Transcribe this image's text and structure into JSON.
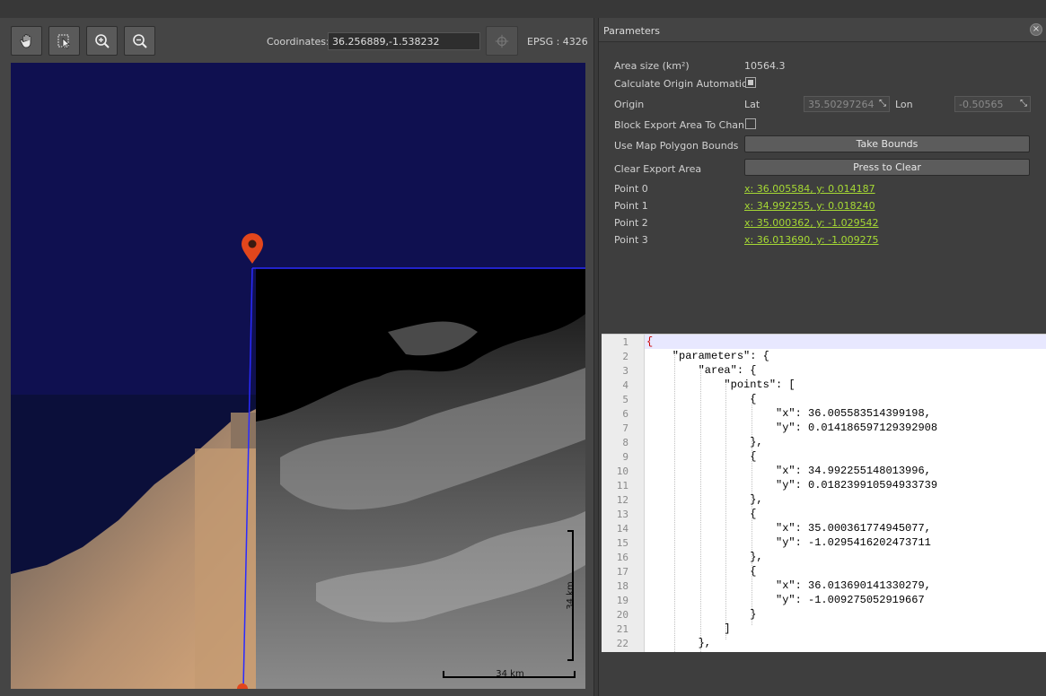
{
  "toolbar": {
    "tools": [
      {
        "name": "pan-tool",
        "icon": "hand-icon"
      },
      {
        "name": "select-tool",
        "icon": "select-cursor-icon"
      },
      {
        "name": "zoom-in-tool",
        "icon": "zoom-in-icon"
      },
      {
        "name": "zoom-out-tool",
        "icon": "zoom-out-icon"
      }
    ],
    "coordinates_label": "Coordinates:",
    "coordinates_value": "36.256889,-1.538232",
    "go_icon": "locate-icon",
    "epsg_label": "EPSG : 4326"
  },
  "map": {
    "scale_label_vertical": "34 km",
    "scale_label_horizontal": "34 km",
    "marker_icon": "map-pin-icon",
    "colors": {
      "water": "#0f1050",
      "marker": "#e2461c",
      "polygon": "#2a2aff"
    }
  },
  "parameters": {
    "title": "Parameters",
    "rows": {
      "area_size_label": "Area size (km²)",
      "area_size_value": "10564.3",
      "calc_origin_label": "Calculate Origin Automatic...",
      "calc_origin_checked": true,
      "origin_label": "Origin",
      "lat_label": "Lat",
      "lat_value": "35.50297264",
      "lon_label": "Lon",
      "lon_value": "-0.50565",
      "block_export_label": "Block Export Area To Chan...",
      "block_export_checked": false,
      "use_bounds_label": "Use Map Polygon Bounds",
      "take_bounds_button": "Take Bounds",
      "clear_export_label": "Clear Export Area",
      "clear_button": "Press to Clear"
    },
    "points": [
      {
        "label": "Point 0",
        "value": "x: 36.005584, y: 0.014187"
      },
      {
        "label": "Point 1",
        "value": "x: 34.992255, y: 0.018240"
      },
      {
        "label": "Point 2",
        "value": "x: 35.000362, y: -1.029542"
      },
      {
        "label": "Point 3",
        "value": "x: 36.013690, y: -1.009275"
      }
    ]
  },
  "editor": {
    "line_numbers": [
      "1",
      "2",
      "3",
      "4",
      "5",
      "6",
      "7",
      "8",
      "9",
      "10",
      "11",
      "12",
      "13",
      "14",
      "15",
      "16",
      "17",
      "18",
      "19",
      "20",
      "21",
      "22"
    ],
    "lines": [
      "{",
      "    \"parameters\": {",
      "        \"area\": {",
      "            \"points\": [",
      "                {",
      "                    \"x\": 36.005583514399198,",
      "                    \"y\": 0.014186597129392908",
      "                },",
      "                {",
      "                    \"x\": 34.992255148013996,",
      "                    \"y\": 0.018239910594933739",
      "                },",
      "                {",
      "                    \"x\": 35.000361774945077,",
      "                    \"y\": -1.0295416202473711",
      "                },",
      "                {",
      "                    \"x\": 36.013690141330279,",
      "                    \"y\": -1.009275052919667",
      "                }",
      "            ]",
      "        },"
    ]
  }
}
